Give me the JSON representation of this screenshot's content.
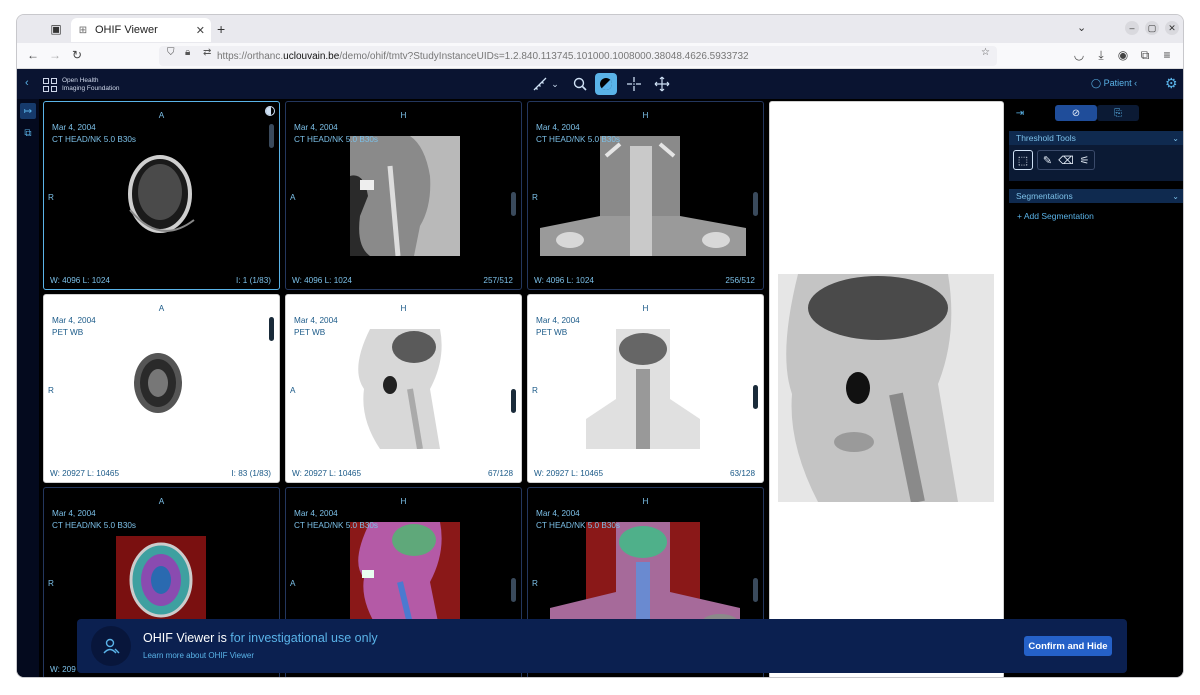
{
  "browser": {
    "tab_title": "OHIF Viewer",
    "url_prefix": "https://orthanc.",
    "url_host": "uclouvain.be",
    "url_path": "/demo/ohif/tmtv?StudyInstanceUIDs=1.2.840.113745.101000.1008000.38048.4626.5933732"
  },
  "app": {
    "logo_line1": "Open Health",
    "logo_line2": "Imaging Foundation",
    "patient_label": "Patient"
  },
  "viewports": [
    {
      "orient_top": "A",
      "date": "Mar 4, 2004",
      "series": "CT HEAD/NK 5.0 B30s",
      "left": "R",
      "wl": "W:  4096   L:  1024",
      "frame": "I: 1 (1/83)"
    },
    {
      "orient_top": "H",
      "date": "Mar 4, 2004",
      "series": "CT HEAD/NK 5.0 B30s",
      "left": "A",
      "wl": "W:  4096   L:  1024",
      "frame": "257/512"
    },
    {
      "orient_top": "H",
      "date": "Mar 4, 2004",
      "series": "CT HEAD/NK 5.0 B30s",
      "left": "R",
      "wl": "W:  4096   L:  1024",
      "frame": "256/512"
    },
    {
      "orient_top": "A",
      "date": "Mar 4, 2004",
      "series": "PET WB",
      "left": "R",
      "wl": "W:  20927   L:  10465",
      "frame": "I: 83 (1/83)"
    },
    {
      "orient_top": "H",
      "date": "Mar 4, 2004",
      "series": "PET WB",
      "left": "A",
      "wl": "W:  20927   L:  10465",
      "frame": "67/128"
    },
    {
      "orient_top": "H",
      "date": "Mar 4, 2004",
      "series": "PET WB",
      "left": "R",
      "wl": "W:  20927   L:  10465",
      "frame": "63/128"
    },
    {
      "orient_top": "A",
      "date": "Mar 4, 2004",
      "series": "CT HEAD/NK 5.0 B30s",
      "left": "R",
      "wl": "W:  209",
      "frame": ""
    },
    {
      "orient_top": "H",
      "date": "Mar 4, 2004",
      "series": "CT HEAD/NK 5.0 B30s",
      "left": "A",
      "wl": "",
      "frame": ""
    },
    {
      "orient_top": "H",
      "date": "Mar 4, 2004",
      "series": "CT HEAD/NK 5.0 B30s",
      "left": "R",
      "wl": "",
      "frame": ""
    }
  ],
  "panel": {
    "threshold_tools": "Threshold Tools",
    "segmentations": "Segmentations",
    "add_segmentation": "Add Segmentation"
  },
  "banner": {
    "title_prefix": "OHIF Viewer is ",
    "title_highlight": "for investigational use only",
    "link": "Learn more about OHIF Viewer",
    "button": "Confirm and Hide"
  },
  "colors": {
    "accent": "#5ab3e8",
    "header_bg": "#0a1431",
    "banner_bg": "#0b2050",
    "button_bg": "#2561c8"
  }
}
